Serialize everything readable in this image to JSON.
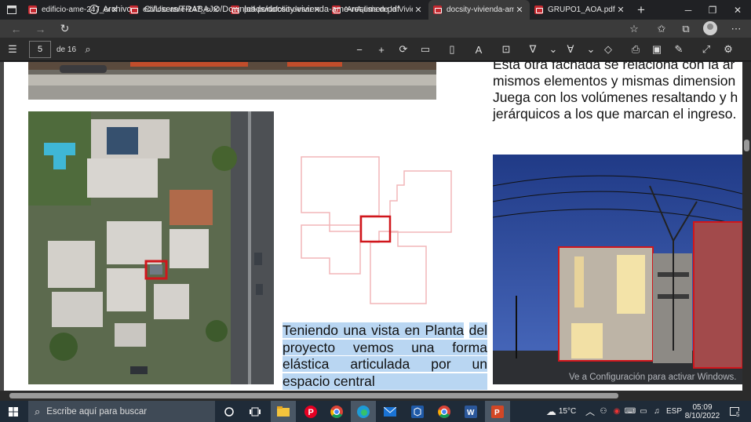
{
  "browser": {
    "tabs": [
      {
        "label": "edificio-ame-247_com",
        "active": false
      },
      {
        "label": "edificio-ame-247_com",
        "active": false
      },
      {
        "label": "pdf-portafolio-desarr",
        "active": false
      },
      {
        "label": "'AnÃ¡lisis de la Viviend",
        "active": false
      },
      {
        "label": "docsity-vivienda-ame-",
        "active": true
      },
      {
        "label": "GRUPO1_AOA.pdf",
        "active": false
      }
    ],
    "address_label": "Archivo",
    "url": "C:/Users/TRABAJO/Downloads/docsity-vivienda-ame-resumen.pdf"
  },
  "pdf_toolbar": {
    "current_page": "5",
    "total_pages": "de 16"
  },
  "document": {
    "paragraph_lines": [
      "Esta otra fachada se relaciona con la ar",
      "mismos elementos y mismas dimension",
      "Juega con los volúmenes resaltando y h",
      "jerárquicos a los que marcan el ingreso."
    ],
    "caption_lines": [
      "Teniendo una vista en Planta",
      "del proyecto vemos una forma",
      "elástica articulada por un"
    ],
    "caption_last_line": "espacio central",
    "watermark": "Ve a Configuración para activar Windows."
  },
  "taskbar": {
    "search_placeholder": "Escribe aquí para buscar",
    "weather": "15°C",
    "language": "ESP",
    "time": "05:09",
    "date": "8/10/2022",
    "notification_count": "5"
  },
  "colors": {
    "highlight": "#b9d6f2",
    "accent_red": "#d0161c",
    "pale_red": "#f2b6b8"
  }
}
